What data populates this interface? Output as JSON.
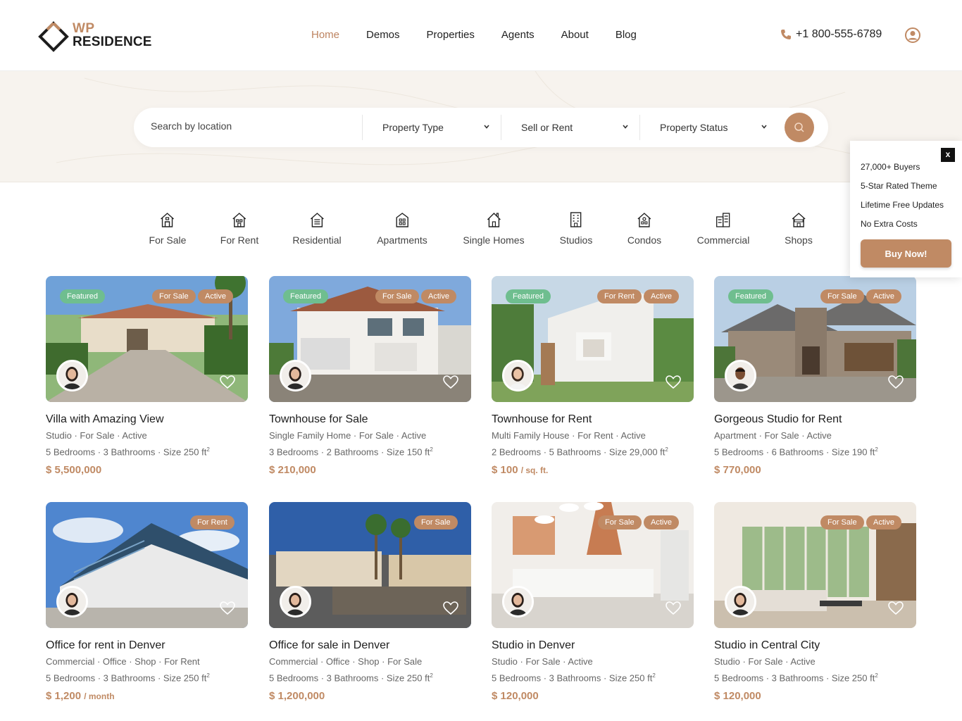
{
  "brand": {
    "logo_top": "WP",
    "logo_bottom": "RESIDENCE",
    "accent": "#c08a64",
    "featured_color": "#6fbe8f"
  },
  "nav": {
    "items": [
      "Home",
      "Demos",
      "Properties",
      "Agents",
      "About",
      "Blog"
    ],
    "active": "Home"
  },
  "contact": {
    "phone": "+1 800-555-6789",
    "phone_icon": "phone-icon",
    "user_icon": "user-icon"
  },
  "search": {
    "placeholder": "Search by location",
    "property_type": "Property Type",
    "sell_or_rent": "Sell or Rent",
    "property_status": "Property Status",
    "button_icon": "search-icon"
  },
  "categories": [
    "For Sale",
    "For Rent",
    "Residential",
    "Apartments",
    "Single Homes",
    "Studios",
    "Condos",
    "Commercial",
    "Shops"
  ],
  "popup": {
    "close": "x",
    "lines": [
      "27,000+ Buyers",
      "5-Star Rated Theme",
      "Lifetime Free Updates",
      "No Extra Costs"
    ],
    "button": "Buy Now!"
  },
  "listings": [
    {
      "featured": "Featured",
      "tags": [
        "For Sale",
        "Active"
      ],
      "title": "Villa with Amazing View",
      "meta": "Studio · For Sale · Active",
      "specs": "5 Bedrooms · 3 Bathrooms · Size 250 ft",
      "sup": "2",
      "price": "$ 5,500,000",
      "price_suffix": ""
    },
    {
      "featured": "Featured",
      "tags": [
        "For Sale",
        "Active"
      ],
      "title": "Townhouse for Sale",
      "meta": "Single Family Home · For Sale · Active",
      "specs": "3 Bedrooms · 2 Bathrooms · Size 150 ft",
      "sup": "2",
      "price": "$ 210,000",
      "price_suffix": ""
    },
    {
      "featured": "Featured",
      "tags": [
        "For Rent",
        "Active"
      ],
      "title": "Townhouse for Rent",
      "meta": "Multi Family House · For Rent · Active",
      "specs": "2 Bedrooms · 5 Bathrooms · Size 29,000 ft",
      "sup": "2",
      "price": "$ 100",
      "price_suffix": "/ sq. ft."
    },
    {
      "featured": "Featured",
      "tags": [
        "For Sale",
        "Active"
      ],
      "title": "Gorgeous Studio for Rent",
      "meta": "Apartment · For Sale · Active",
      "specs": "5 Bedrooms · 6 Bathrooms · Size 190 ft",
      "sup": "2",
      "price": "$ 770,000",
      "price_suffix": ""
    },
    {
      "featured": "",
      "tags": [
        "For Rent"
      ],
      "title": "Office for rent in Denver",
      "meta": "Commercial · Office · Shop · For Rent",
      "specs": "5 Bedrooms · 3 Bathrooms · Size 250 ft",
      "sup": "2",
      "price": "$ 1,200",
      "price_suffix": "/ month"
    },
    {
      "featured": "",
      "tags": [
        "For Sale"
      ],
      "title": "Office for sale in Denver",
      "meta": "Commercial · Office · Shop · For Sale",
      "specs": "5 Bedrooms · 3 Bathrooms · Size 250 ft",
      "sup": "2",
      "price": "$ 1,200,000",
      "price_suffix": ""
    },
    {
      "featured": "",
      "tags": [
        "For Sale",
        "Active"
      ],
      "title": "Studio in Denver",
      "meta": "Studio · For Sale · Active",
      "specs": "5 Bedrooms · 3 Bathrooms · Size 250 ft",
      "sup": "2",
      "price": "$ 120,000",
      "price_suffix": ""
    },
    {
      "featured": "",
      "tags": [
        "For Sale",
        "Active"
      ],
      "title": "Studio in Central City",
      "meta": "Studio · For Sale · Active",
      "specs": "5 Bedrooms · 3 Bathrooms · Size 250 ft",
      "sup": "2",
      "price": "$ 120,000",
      "price_suffix": ""
    }
  ]
}
